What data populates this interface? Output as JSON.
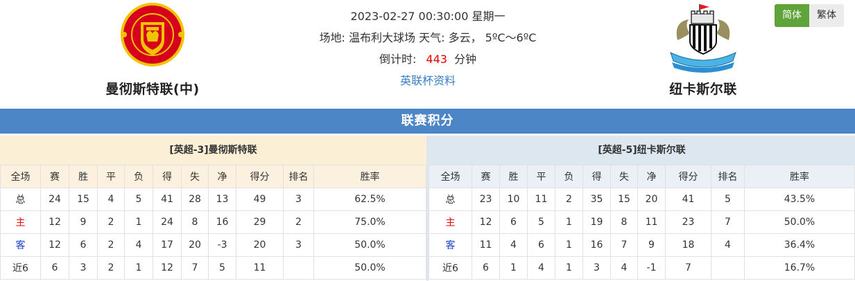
{
  "match": {
    "datetime": "2023-02-27 00:30:00 星期一",
    "venue_weather": "场地: 温布利大球场 天气: 多云， 5ºC～6ºC",
    "countdown_label": "倒计时:",
    "countdown_value": "443",
    "countdown_unit": "分钟",
    "cup_link": "英联杯资料"
  },
  "home_team": {
    "name": "曼彻斯特联(中)",
    "logo_icon": "manchester-united-crest"
  },
  "away_team": {
    "name": "纽卡斯尔联",
    "logo_icon": "newcastle-united-crest"
  },
  "lang": {
    "simplified": "简体",
    "traditional": "繁体"
  },
  "standings": {
    "title": "联赛积分",
    "columns": [
      "全场",
      "赛",
      "胜",
      "平",
      "负",
      "得",
      "失",
      "净",
      "得分",
      "排名",
      "胜率"
    ],
    "home": {
      "caption": "[英超-3]曼彻斯特联",
      "rows": [
        [
          "总",
          "24",
          "15",
          "4",
          "5",
          "41",
          "28",
          "13",
          "49",
          "3",
          "62.5%"
        ],
        [
          "主",
          "12",
          "9",
          "2",
          "1",
          "24",
          "8",
          "16",
          "29",
          "2",
          "75.0%"
        ],
        [
          "客",
          "12",
          "6",
          "2",
          "4",
          "17",
          "20",
          "-3",
          "20",
          "3",
          "50.0%"
        ],
        [
          "近6",
          "6",
          "3",
          "2",
          "1",
          "12",
          "7",
          "5",
          "11",
          "",
          "50.0%"
        ]
      ]
    },
    "away": {
      "caption": "[英超-5]纽卡斯尔联",
      "rows": [
        [
          "总",
          "23",
          "10",
          "11",
          "2",
          "35",
          "15",
          "20",
          "41",
          "5",
          "43.5%"
        ],
        [
          "主",
          "12",
          "6",
          "5",
          "1",
          "19",
          "8",
          "11",
          "23",
          "7",
          "50.0%"
        ],
        [
          "客",
          "11",
          "4",
          "6",
          "1",
          "16",
          "7",
          "9",
          "18",
          "4",
          "36.4%"
        ],
        [
          "近6",
          "6",
          "1",
          "4",
          "1",
          "3",
          "4",
          "-1",
          "7",
          "",
          "16.7%"
        ]
      ]
    }
  },
  "colors": {
    "title_bar": "#4d86c6",
    "home_panel": "#fbefd6",
    "away_panel": "#dde7f0",
    "home_label": "#e60000",
    "away_label": "#1c3fc6",
    "countdown": "#e60000",
    "lang_active": "#5fa33b"
  }
}
